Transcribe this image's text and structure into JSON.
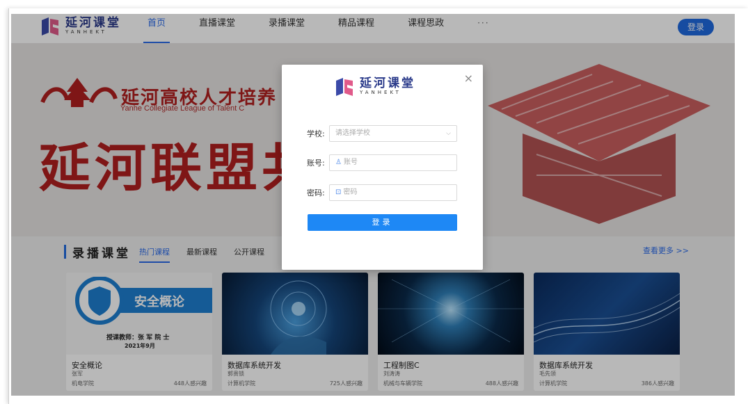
{
  "nav": {
    "logo_cn": "延河课堂",
    "logo_en": "YANHEKT",
    "links": [
      "首页",
      "直播课堂",
      "录播课堂",
      "精品课程",
      "课程思政"
    ],
    "more": "···",
    "login": "登录"
  },
  "banner": {
    "title1": "延河高校人才培养",
    "subtitle": "Yanhe Collegiate League of Talent C",
    "title2": "延河联盟共"
  },
  "section": {
    "title": "录播课堂",
    "tabs": [
      "热门课程",
      "最新课程",
      "公开课程"
    ],
    "see_more": "查看更多 >>",
    "cards": [
      {
        "name": "安全概论",
        "teacher": "张军",
        "college": "机电学院",
        "count": "448人感兴趣",
        "cover_title": "安全概论",
        "cover_teacher": "授课教师：张 军 院 士",
        "cover_date": "2021年9月"
      },
      {
        "name": "数据库系统开发",
        "teacher": "郭贵锁",
        "college": "计算机学院",
        "count": "725人感兴趣"
      },
      {
        "name": "工程制图C",
        "teacher": "刘涛涛",
        "college": "机械与车辆学院",
        "count": "488人感兴趣"
      },
      {
        "name": "数据库系统开发",
        "teacher": "毛先领",
        "college": "计算机学院",
        "count": "386人感兴趣"
      }
    ]
  },
  "modal": {
    "close": "×",
    "logo_cn": "延河课堂",
    "logo_en": "YANHEKT",
    "school_label": "学校:",
    "school_placeholder": "请选择学校",
    "account_label": "账号:",
    "account_placeholder": "账号",
    "password_label": "密码:",
    "password_placeholder": "密码",
    "submit": "登录"
  },
  "colors": {
    "accent": "#1f6ae0",
    "brand_red": "#b11f1f"
  }
}
